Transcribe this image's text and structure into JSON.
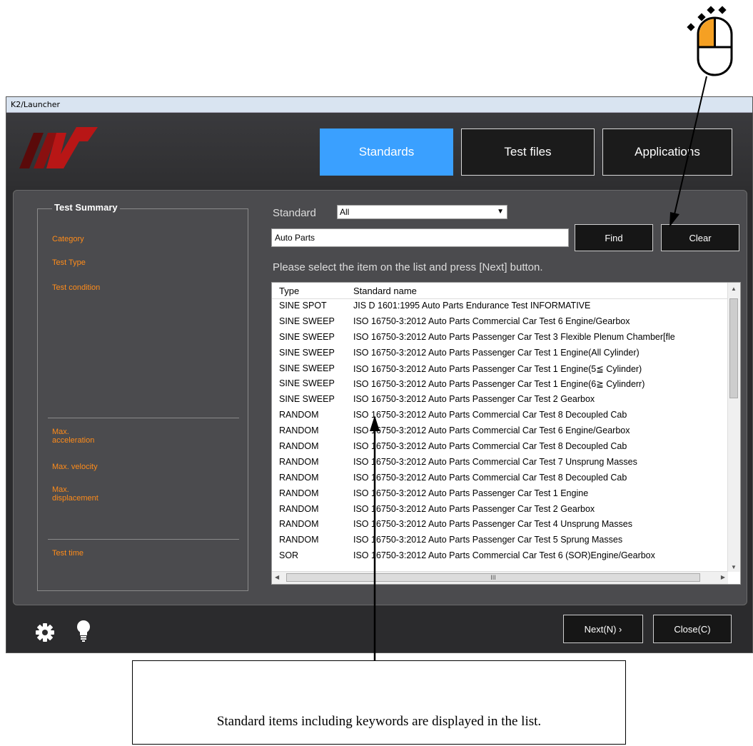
{
  "window": {
    "title": "K2/Launcher"
  },
  "nav": {
    "standards": "Standards",
    "test_files": "Test files",
    "applications": "Applications"
  },
  "summary": {
    "title": "Test Summary",
    "category": "Category",
    "test_type": "Test Type",
    "test_condition": "Test condition",
    "max_accel": "Max.\nacceleration",
    "max_velocity": "Max. velocity",
    "max_disp": "Max.\ndisplacement",
    "test_time": "Test time"
  },
  "filter": {
    "standard_label": "Standard",
    "standard_value": "All",
    "search_value": "Auto Parts",
    "find": "Find",
    "clear": "Clear",
    "instruction": "Please select the item on the list and press [Next] button."
  },
  "list": {
    "col_type": "Type",
    "col_name": "Standard name",
    "rows": [
      {
        "type": "SINE SPOT",
        "name": "JIS D 1601:1995 Auto Parts Endurance Test INFORMATIVE"
      },
      {
        "type": "SINE SWEEP",
        "name": "ISO 16750-3:2012 Auto Parts Commercial Car Test 6 Engine/Gearbox"
      },
      {
        "type": "SINE SWEEP",
        "name": "ISO 16750-3:2012 Auto Parts Passenger Car Test 3 Flexible Plenum Chamber[fle"
      },
      {
        "type": "SINE SWEEP",
        "name": "ISO 16750-3:2012 Auto Parts Passenger Car Test 1 Engine(All Cylinder)"
      },
      {
        "type": "SINE SWEEP",
        "name": "ISO 16750-3:2012 Auto Parts Passenger Car Test 1 Engine(5≦ Cylinder)"
      },
      {
        "type": "SINE SWEEP",
        "name": "ISO 16750-3:2012 Auto Parts Passenger Car Test 1 Engine(6≧ Cylinderr)"
      },
      {
        "type": "SINE SWEEP",
        "name": "ISO 16750-3:2012 Auto Parts Passenger Car Test 2 Gearbox"
      },
      {
        "type": "RANDOM",
        "name": "ISO 16750-3:2012 Auto Parts Commercial Car Test 8 Decoupled Cab"
      },
      {
        "type": "RANDOM",
        "name": "ISO 16750-3:2012 Auto Parts Commercial Car Test 6 Engine/Gearbox"
      },
      {
        "type": "RANDOM",
        "name": "ISO 16750-3:2012 Auto Parts Commercial Car Test 8 Decoupled Cab"
      },
      {
        "type": "RANDOM",
        "name": "ISO 16750-3:2012 Auto Parts Commercial Car Test 7 Unsprung Masses"
      },
      {
        "type": "RANDOM",
        "name": "ISO 16750-3:2012 Auto Parts Commercial Car Test 8 Decoupled Cab"
      },
      {
        "type": "RANDOM",
        "name": "ISO 16750-3:2012 Auto Parts Passenger Car Test 1 Engine"
      },
      {
        "type": "RANDOM",
        "name": "ISO 16750-3:2012 Auto Parts Passenger Car Test 2 Gearbox"
      },
      {
        "type": "RANDOM",
        "name": "ISO 16750-3:2012 Auto Parts Passenger Car Test 4 Unsprung Masses"
      },
      {
        "type": "RANDOM",
        "name": "ISO 16750-3:2012 Auto Parts Passenger Car Test 5 Sprung Masses"
      },
      {
        "type": "SOR",
        "name": "ISO 16750-3:2012 Auto Parts Commercial Car Test 6 (SOR)Engine/Gearbox"
      }
    ],
    "hscroll_thumb": "III"
  },
  "footer": {
    "next": "Next(N) ›",
    "close": "Close(C)",
    "icons": [
      "gear-icon",
      "lightbulb-icon"
    ]
  },
  "annotation": {
    "text": "Standard items including keywords are displayed in the list."
  },
  "colors": {
    "accent": "#3aa0ff",
    "label_orange": "#ff8c1a",
    "bg": "#2b2b2d"
  }
}
